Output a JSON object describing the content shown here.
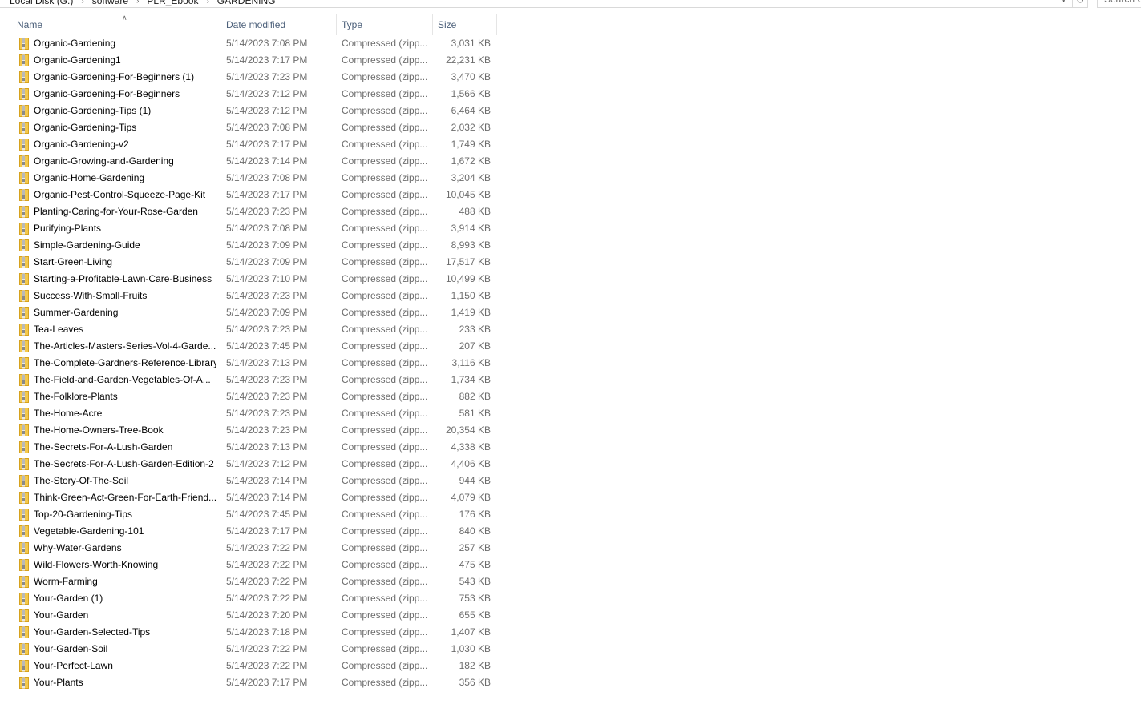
{
  "address_bar": {
    "breadcrumbs": [
      "Local Disk (G:)",
      "software",
      "PLR_Ebook",
      "GARDENING"
    ],
    "search_placeholder": "Search G"
  },
  "columns": {
    "name": "Name",
    "date": "Date modified",
    "type": "Type",
    "size": "Size",
    "sorted_by": "Name"
  },
  "files": [
    {
      "name": "Organic-Gardening",
      "date": "5/14/2023 7:08 PM",
      "type": "Compressed (zipp...",
      "size": "3,031 KB"
    },
    {
      "name": "Organic-Gardening1",
      "date": "5/14/2023 7:17 PM",
      "type": "Compressed (zipp...",
      "size": "22,231 KB"
    },
    {
      "name": "Organic-Gardening-For-Beginners (1)",
      "date": "5/14/2023 7:23 PM",
      "type": "Compressed (zipp...",
      "size": "3,470 KB"
    },
    {
      "name": "Organic-Gardening-For-Beginners",
      "date": "5/14/2023 7:12 PM",
      "type": "Compressed (zipp...",
      "size": "1,566 KB"
    },
    {
      "name": "Organic-Gardening-Tips (1)",
      "date": "5/14/2023 7:12 PM",
      "type": "Compressed (zipp...",
      "size": "6,464 KB"
    },
    {
      "name": "Organic-Gardening-Tips",
      "date": "5/14/2023 7:08 PM",
      "type": "Compressed (zipp...",
      "size": "2,032 KB"
    },
    {
      "name": "Organic-Gardening-v2",
      "date": "5/14/2023 7:17 PM",
      "type": "Compressed (zipp...",
      "size": "1,749 KB"
    },
    {
      "name": "Organic-Growing-and-Gardening",
      "date": "5/14/2023 7:14 PM",
      "type": "Compressed (zipp...",
      "size": "1,672 KB"
    },
    {
      "name": "Organic-Home-Gardening",
      "date": "5/14/2023 7:08 PM",
      "type": "Compressed (zipp...",
      "size": "3,204 KB"
    },
    {
      "name": "Organic-Pest-Control-Squeeze-Page-Kit",
      "date": "5/14/2023 7:17 PM",
      "type": "Compressed (zipp...",
      "size": "10,045 KB"
    },
    {
      "name": "Planting-Caring-for-Your-Rose-Garden",
      "date": "5/14/2023 7:23 PM",
      "type": "Compressed (zipp...",
      "size": "488 KB"
    },
    {
      "name": "Purifying-Plants",
      "date": "5/14/2023 7:08 PM",
      "type": "Compressed (zipp...",
      "size": "3,914 KB"
    },
    {
      "name": "Simple-Gardening-Guide",
      "date": "5/14/2023 7:09 PM",
      "type": "Compressed (zipp...",
      "size": "8,993 KB"
    },
    {
      "name": "Start-Green-Living",
      "date": "5/14/2023 7:09 PM",
      "type": "Compressed (zipp...",
      "size": "17,517 KB"
    },
    {
      "name": "Starting-a-Profitable-Lawn-Care-Business",
      "date": "5/14/2023 7:10 PM",
      "type": "Compressed (zipp...",
      "size": "10,499 KB"
    },
    {
      "name": "Success-With-Small-Fruits",
      "date": "5/14/2023 7:23 PM",
      "type": "Compressed (zipp...",
      "size": "1,150 KB"
    },
    {
      "name": "Summer-Gardening",
      "date": "5/14/2023 7:09 PM",
      "type": "Compressed (zipp...",
      "size": "1,419 KB"
    },
    {
      "name": "Tea-Leaves",
      "date": "5/14/2023 7:23 PM",
      "type": "Compressed (zipp...",
      "size": "233 KB"
    },
    {
      "name": "The-Articles-Masters-Series-Vol-4-Garde...",
      "date": "5/14/2023 7:45 PM",
      "type": "Compressed (zipp...",
      "size": "207 KB"
    },
    {
      "name": "The-Complete-Gardners-Reference-Library",
      "date": "5/14/2023 7:13 PM",
      "type": "Compressed (zipp...",
      "size": "3,116 KB"
    },
    {
      "name": "The-Field-and-Garden-Vegetables-Of-A...",
      "date": "5/14/2023 7:23 PM",
      "type": "Compressed (zipp...",
      "size": "1,734 KB"
    },
    {
      "name": "The-Folklore-Plants",
      "date": "5/14/2023 7:23 PM",
      "type": "Compressed (zipp...",
      "size": "882 KB"
    },
    {
      "name": "The-Home-Acre",
      "date": "5/14/2023 7:23 PM",
      "type": "Compressed (zipp...",
      "size": "581 KB"
    },
    {
      "name": "The-Home-Owners-Tree-Book",
      "date": "5/14/2023 7:23 PM",
      "type": "Compressed (zipp...",
      "size": "20,354 KB"
    },
    {
      "name": "The-Secrets-For-A-Lush-Garden",
      "date": "5/14/2023 7:13 PM",
      "type": "Compressed (zipp...",
      "size": "4,338 KB"
    },
    {
      "name": "The-Secrets-For-A-Lush-Garden-Edition-2",
      "date": "5/14/2023 7:12 PM",
      "type": "Compressed (zipp...",
      "size": "4,406 KB"
    },
    {
      "name": "The-Story-Of-The-Soil",
      "date": "5/14/2023 7:14 PM",
      "type": "Compressed (zipp...",
      "size": "944 KB"
    },
    {
      "name": "Think-Green-Act-Green-For-Earth-Friend...",
      "date": "5/14/2023 7:14 PM",
      "type": "Compressed (zipp...",
      "size": "4,079 KB"
    },
    {
      "name": "Top-20-Gardening-Tips",
      "date": "5/14/2023 7:45 PM",
      "type": "Compressed (zipp...",
      "size": "176 KB"
    },
    {
      "name": "Vegetable-Gardening-101",
      "date": "5/14/2023 7:17 PM",
      "type": "Compressed (zipp...",
      "size": "840 KB"
    },
    {
      "name": "Why-Water-Gardens",
      "date": "5/14/2023 7:22 PM",
      "type": "Compressed (zipp...",
      "size": "257 KB"
    },
    {
      "name": "Wild-Flowers-Worth-Knowing",
      "date": "5/14/2023 7:22 PM",
      "type": "Compressed (zipp...",
      "size": "475 KB"
    },
    {
      "name": "Worm-Farming",
      "date": "5/14/2023 7:22 PM",
      "type": "Compressed (zipp...",
      "size": "543 KB"
    },
    {
      "name": "Your-Garden (1)",
      "date": "5/14/2023 7:22 PM",
      "type": "Compressed (zipp...",
      "size": "753 KB"
    },
    {
      "name": "Your-Garden",
      "date": "5/14/2023 7:20 PM",
      "type": "Compressed (zipp...",
      "size": "655 KB"
    },
    {
      "name": "Your-Garden-Selected-Tips",
      "date": "5/14/2023 7:18 PM",
      "type": "Compressed (zipp...",
      "size": "1,407 KB"
    },
    {
      "name": "Your-Garden-Soil",
      "date": "5/14/2023 7:22 PM",
      "type": "Compressed (zipp...",
      "size": "1,030 KB"
    },
    {
      "name": "Your-Perfect-Lawn",
      "date": "5/14/2023 7:22 PM",
      "type": "Compressed (zipp...",
      "size": "182 KB"
    },
    {
      "name": "Your-Plants",
      "date": "5/14/2023 7:17 PM",
      "type": "Compressed (zipp...",
      "size": "356 KB"
    }
  ],
  "icons": {
    "file_icon": "zip-folder-icon",
    "folder_color": "#f4c94c",
    "zipper_color": "#8a8a8a"
  }
}
